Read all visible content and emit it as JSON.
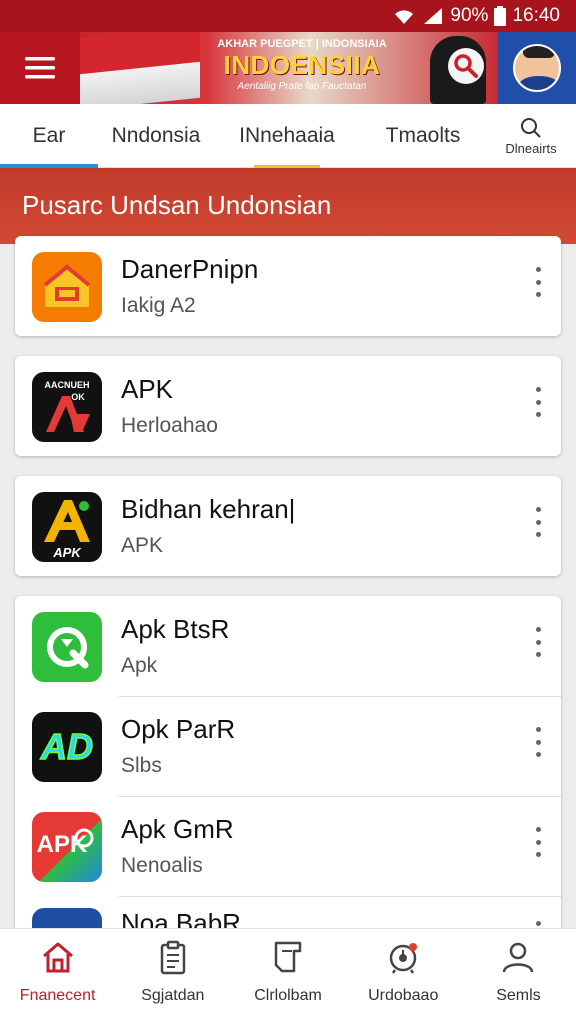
{
  "status_bar": {
    "battery": "90%",
    "time": "16:40"
  },
  "header": {
    "banner_top": "AKHAR PUEGPET | INDONSIAIA",
    "banner_main": "INDOENSIIA",
    "banner_sub": "Aentaliig Prate fao Fauctatan",
    "menu_icon": "hamburger-menu-icon",
    "search_icon": "search-icon"
  },
  "tabs": [
    {
      "label": "Ear",
      "active": true
    },
    {
      "label": "Nndonsia",
      "active": false
    },
    {
      "label": "INnehaaia",
      "active": false,
      "highlight": true
    },
    {
      "label": "Tmaolts",
      "active": false
    },
    {
      "label": "Dlneairts",
      "icon": "search-icon"
    }
  ],
  "section": {
    "title": "Pusarc Undsan Undonsian"
  },
  "apps": [
    {
      "name": "DanerPnipn",
      "sub": "Iakig A2",
      "icon": "house-app-icon",
      "color": "#f57c00"
    },
    {
      "name": "APK",
      "sub": "Herloahao",
      "icon": "apk-a-red-icon",
      "color": "#111111",
      "icon_text": "AACNUEH",
      "icon_text2": "OK"
    },
    {
      "name": "Bidhan kehran|",
      "sub": "APK",
      "icon": "apk-a-gold-icon",
      "color": "#111111",
      "icon_text": "APK"
    },
    {
      "name": "Apk BtsR",
      "sub": "Apk",
      "icon": "green-refresh-icon",
      "color": "#2fbd3c"
    },
    {
      "name": "Opk ParR",
      "sub": "Slbs",
      "icon": "neon-ad-icon",
      "color": "#111111",
      "icon_text": "AD"
    },
    {
      "name": "Apk GmR",
      "sub": "Nenoalis",
      "icon": "apk-red-green-icon",
      "color": "#e53935",
      "icon_text": "APK"
    },
    {
      "name": "Noa BabR",
      "sub": "",
      "icon": "clock-app-icon",
      "color": "#1e4fa3"
    }
  ],
  "bottom_nav": [
    {
      "label": "Fnanecent",
      "icon": "home-icon",
      "active": true
    },
    {
      "label": "Sgjatdan",
      "icon": "clipboard-icon",
      "active": false
    },
    {
      "label": "Clrlolbam",
      "icon": "document-icon",
      "active": false
    },
    {
      "label": "Urdobaao",
      "icon": "alarm-icon",
      "active": false
    },
    {
      "label": "Semls",
      "icon": "person-icon",
      "active": false
    }
  ],
  "colors": {
    "brand_red": "#b5161f",
    "section_red": "#c03a2b",
    "tab_active": "#2a8fd6",
    "tab_highlight": "#f2c230"
  }
}
